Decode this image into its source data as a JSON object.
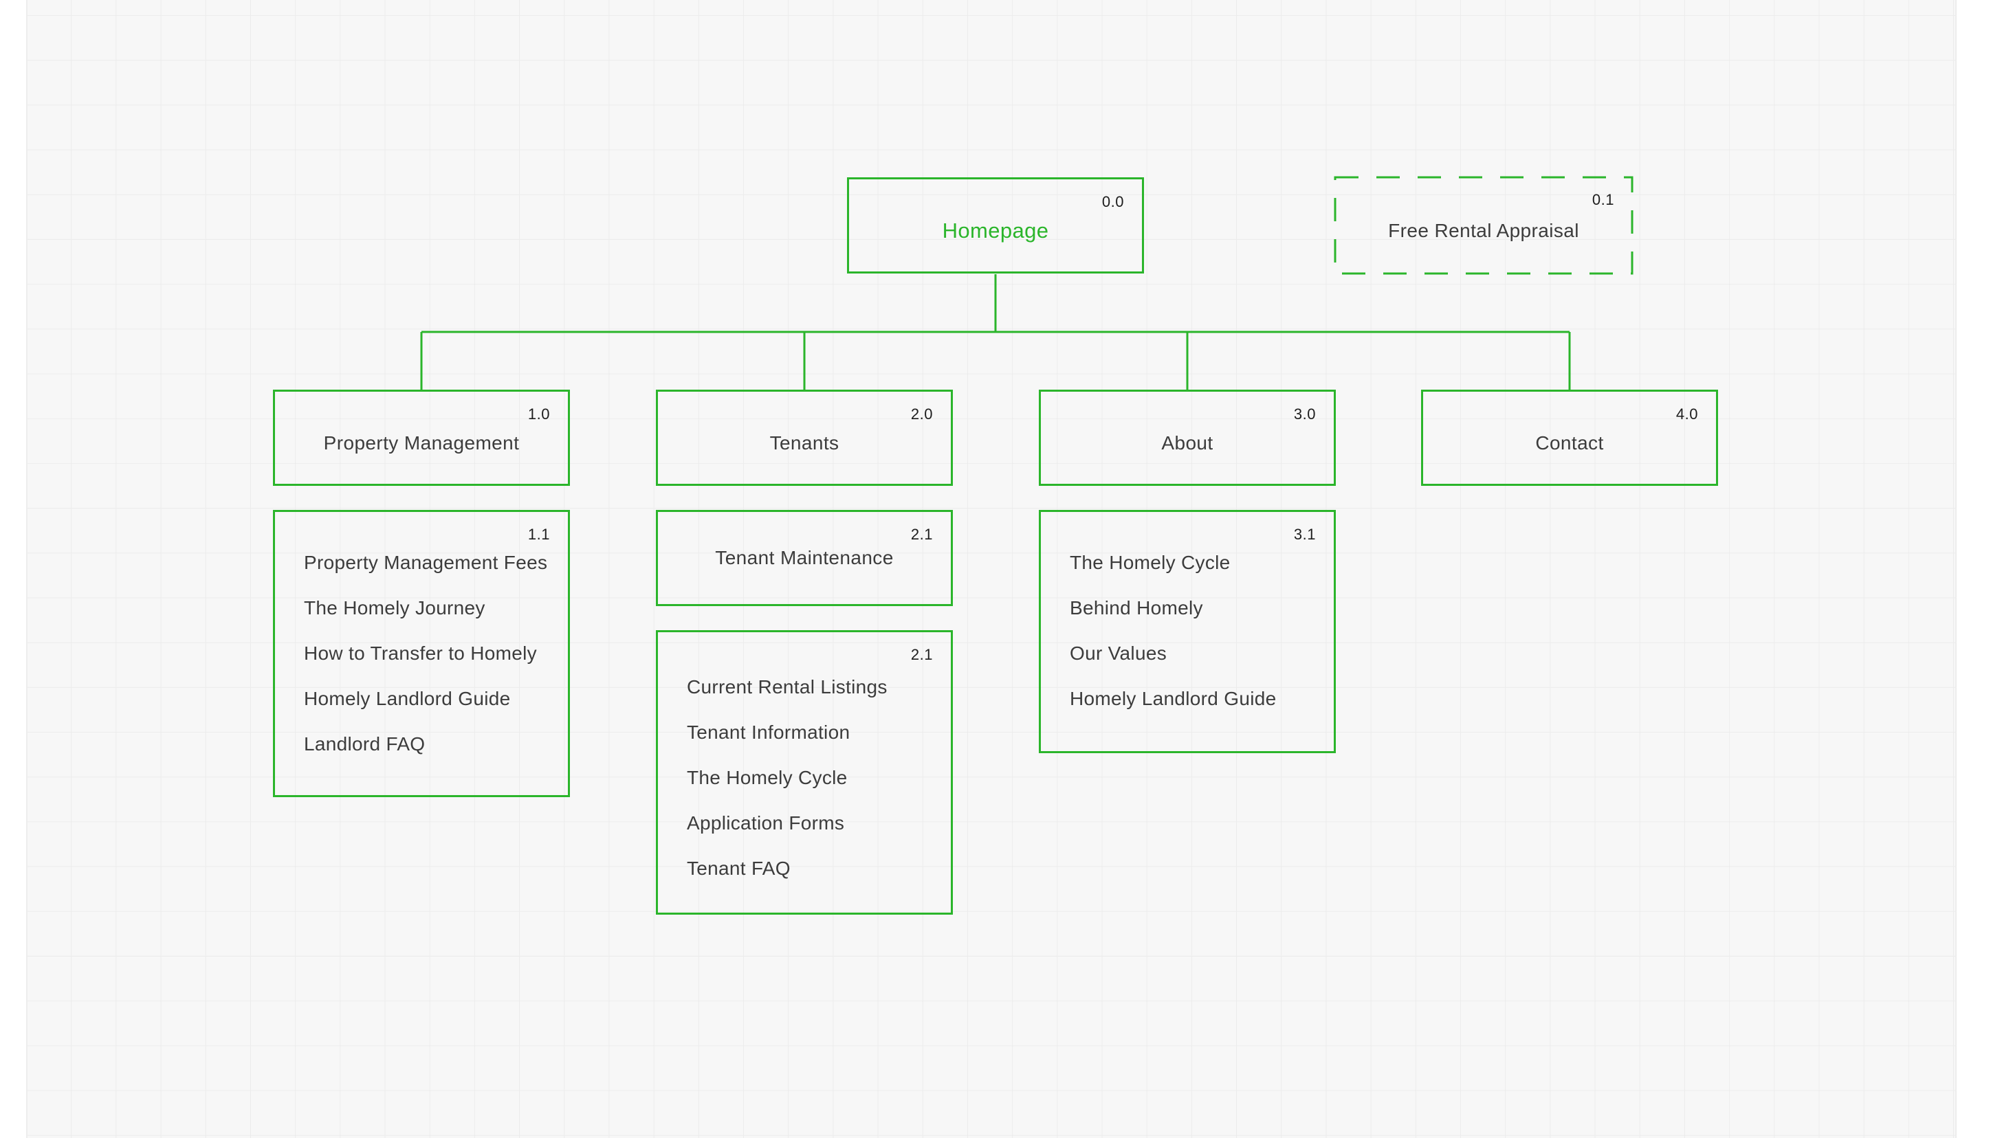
{
  "diagram": {
    "colors": {
      "accent": "#2bb52b",
      "text": "#3c3c3c",
      "number": "#1d1d1d",
      "grid": "#ececec",
      "background": "#f7f7f7"
    },
    "homepage": {
      "number": "0.0",
      "label": "Homepage"
    },
    "appraisal": {
      "number": "0.1",
      "label": "Free Rental Appraisal",
      "style": "dashed"
    },
    "sections": [
      {
        "number": "1.0",
        "label": "Property Management"
      },
      {
        "number": "2.0",
        "label": "Tenants"
      },
      {
        "number": "3.0",
        "label": "About"
      },
      {
        "number": "4.0",
        "label": "Contact"
      }
    ],
    "subsections": {
      "property_management": {
        "number": "1.1",
        "items": [
          "Property Management Fees",
          "The Homely Journey",
          "How to Transfer to Homely",
          "Homely Landlord Guide",
          "Landlord FAQ"
        ]
      },
      "tenant_maintenance": {
        "number": "2.1",
        "label": "Tenant Maintenance"
      },
      "tenants": {
        "number": "2.1",
        "items": [
          "Current Rental Listings",
          "Tenant Information",
          "The Homely Cycle",
          "Application Forms",
          "Tenant FAQ"
        ]
      },
      "about": {
        "number": "3.1",
        "items": [
          "The Homely Cycle",
          "Behind Homely",
          "Our Values",
          "Homely Landlord Guide"
        ]
      }
    }
  }
}
